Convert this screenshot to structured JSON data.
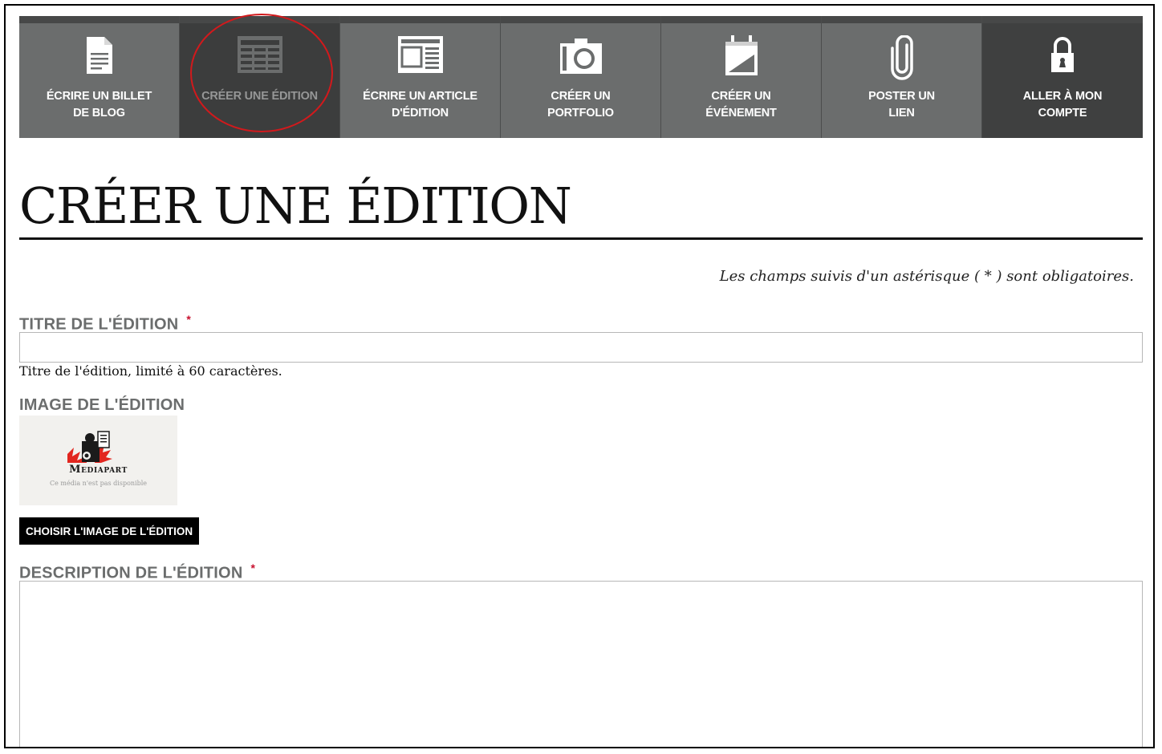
{
  "nav": {
    "items": [
      {
        "label": "ÉCRIRE UN BILLET\nDE BLOG",
        "icon": "document-icon"
      },
      {
        "label": "CRÉER UNE ÉDITION",
        "icon": "newspaper-icon",
        "selected": true
      },
      {
        "label": "ÉCRIRE UN ARTICLE\nD'ÉDITION",
        "icon": "article-icon"
      },
      {
        "label": "CRÉER UN\nPORTFOLIO",
        "icon": "camera-icon"
      },
      {
        "label": "CRÉER UN\nÉVÉNEMENT",
        "icon": "calendar-icon"
      },
      {
        "label": "POSTER UN\nLIEN",
        "icon": "paperclip-icon"
      },
      {
        "label": "ALLER À MON\nCOMPTE",
        "icon": "lock-icon"
      }
    ]
  },
  "page": {
    "title": "CRÉER UNE ÉDITION",
    "required_note": "Les champs suivis d'un astérisque ( * ) sont obligatoires."
  },
  "form": {
    "title_field": {
      "label": "TITRE DE L'ÉDITION",
      "required_mark": "*",
      "value": "",
      "help": "Titre de l'édition, limité à 60 caractères."
    },
    "image_field": {
      "label": "IMAGE DE L'ÉDITION",
      "logo_text": "Mediapart",
      "unavailable_text": "Ce média n'est pas disponible",
      "button_label": "CHOISIR L'IMAGE DE L'ÉDITION"
    },
    "description_field": {
      "label": "DESCRIPTION DE L'ÉDITION",
      "required_mark": "*",
      "value": ""
    }
  },
  "colors": {
    "nav_tile": "#6b6d6d",
    "nav_selected": "#3c3d3d",
    "highlight": "#d2191c",
    "required": "#c8102e",
    "label": "#6b6d6d"
  }
}
